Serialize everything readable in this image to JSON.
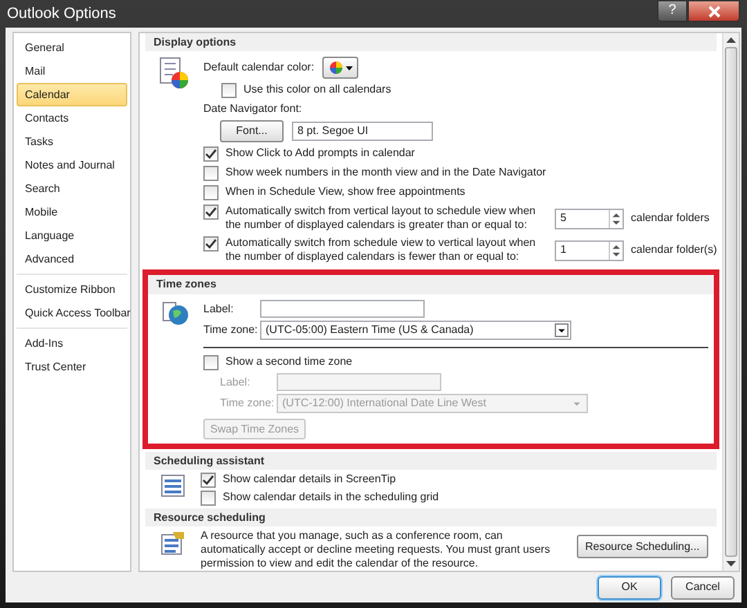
{
  "window": {
    "title": "Outlook Options",
    "help": "?"
  },
  "sidebar": {
    "groups": [
      [
        {
          "label": "General",
          "selected": false
        },
        {
          "label": "Mail",
          "selected": false
        },
        {
          "label": "Calendar",
          "selected": true
        },
        {
          "label": "Contacts",
          "selected": false
        },
        {
          "label": "Tasks",
          "selected": false
        },
        {
          "label": "Notes and Journal",
          "selected": false
        },
        {
          "label": "Search",
          "selected": false
        },
        {
          "label": "Mobile",
          "selected": false
        },
        {
          "label": "Language",
          "selected": false
        },
        {
          "label": "Advanced",
          "selected": false
        }
      ],
      [
        {
          "label": "Customize Ribbon",
          "selected": false
        },
        {
          "label": "Quick Access Toolbar",
          "selected": false
        }
      ],
      [
        {
          "label": "Add-Ins",
          "selected": false
        },
        {
          "label": "Trust Center",
          "selected": false
        }
      ]
    ]
  },
  "display_options": {
    "header": "Display options",
    "color_label": "Default calendar color:",
    "use_color_all": {
      "label": "Use this color on all calendars",
      "checked": false
    },
    "font_label": "Date Navigator font:",
    "font_button": "Font...",
    "font_value": "8 pt. Segoe UI",
    "checkboxes": [
      {
        "label": "Show Click to Add prompts in calendar",
        "checked": true
      },
      {
        "label": "Show week numbers in the month view and in the Date Navigator",
        "checked": false
      },
      {
        "label": "When in Schedule View, show free appointments",
        "checked": false
      }
    ],
    "switches": [
      {
        "label": "Automatically switch from vertical layout to schedule view when the number of displayed calendars is greater than or equal to:",
        "checked": true,
        "value": "5",
        "unit": "calendar folders"
      },
      {
        "label": "Automatically switch from schedule view to vertical layout when the number of displayed calendars is fewer than or equal to:",
        "checked": true,
        "value": "1",
        "unit": "calendar folder(s)"
      }
    ]
  },
  "time_zones": {
    "header": "Time zones",
    "label_label": "Label:",
    "time_zone_label": "Time zone:",
    "time_zone_value": "(UTC-05:00) Eastern Time (US & Canada)",
    "second": {
      "label": "Show a second time zone",
      "checked": false
    },
    "second_label_label": "Label:",
    "second_time_zone_label": "Time zone:",
    "second_time_zone_value": "(UTC-12:00) International Date Line West",
    "swap_button": "Swap Time Zones",
    "disabled": true
  },
  "scheduling_assistant": {
    "header": "Scheduling assistant",
    "checkboxes": [
      {
        "label": "Show calendar details in ScreenTip",
        "checked": true
      },
      {
        "label": "Show calendar details in the scheduling grid",
        "checked": false
      }
    ]
  },
  "resource_scheduling": {
    "header": "Resource scheduling",
    "text": "A resource that you manage, such as a conference room, can automatically accept or decline meeting requests. You must grant users permission to view and edit the calendar of the resource.",
    "button": "Resource Scheduling..."
  },
  "footer_buttons": [
    {
      "label": "OK",
      "kind": "default"
    },
    {
      "label": "Cancel",
      "kind": "normal"
    }
  ]
}
